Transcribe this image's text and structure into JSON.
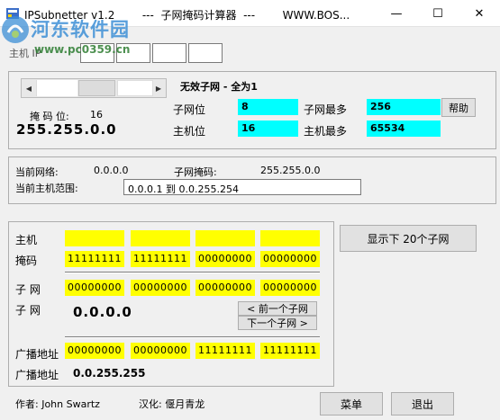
{
  "window": {
    "title": "IPSubnetter v1.2        ---  子网掩码计算器  ---        WWW.BOS...",
    "minimize": "—",
    "maximize": "☐",
    "close": "✕"
  },
  "watermark": {
    "title": "河东软件园",
    "url": "www.pc0359.cn"
  },
  "host_ip": {
    "label": "主机 IP",
    "octets": [
      "",
      "",
      "",
      "",
      ""
    ]
  },
  "mask": {
    "bits_label": "掩 码 位:",
    "bits_value": "16",
    "mask_value": "255.255.0.0",
    "subnet_status": "无效子网 - 全为1",
    "subnet_bits_label": "子网位",
    "subnet_bits_value": "8",
    "max_subnets_label": "子网最多",
    "max_subnets_value": "256",
    "host_bits_label": "主机位",
    "host_bits_value": "16",
    "max_hosts_label": "主机最多",
    "max_hosts_value": "65534",
    "help_button": "帮助",
    "scroll_level": 0.42
  },
  "network": {
    "current_network_label": "当前网络:",
    "current_network_value": "0.0.0.0",
    "subnet_mask_label": "子网掩码:",
    "subnet_mask_value": "255.255.0.0",
    "host_range_label": "当前主机范围:",
    "host_range_value": "0.0.0.1  到  0.0.255.254"
  },
  "binary": {
    "host_label": "主机",
    "host_octets": [
      "",
      "",
      "",
      ""
    ],
    "mask_label": "掩码",
    "mask_octets": [
      "11111111",
      "11111111",
      "00000000",
      "00000000"
    ],
    "subnet_label": "子 网",
    "subnet_octets": [
      "00000000",
      "00000000",
      "00000000",
      "00000000"
    ],
    "subnet2_label": "子 网",
    "subnet_value": "0.0.0.0",
    "prev_subnet": "< 前一个子网",
    "next_subnet": "下一个子网 >",
    "broadcast_label": "广播地址",
    "broadcast_octets": [
      "00000000",
      "00000000",
      "11111111",
      "11111111"
    ],
    "broadcast2_label": "广播地址",
    "broadcast_value": "0.0.255.255"
  },
  "show_subnets_button": "显示下 20个子网",
  "footer": {
    "author": "作者: John Swartz",
    "localizer": "汉化: 偃月青龙",
    "menu_button": "菜单",
    "exit_button": "退出"
  },
  "colors": {
    "cyan": "#00ffff",
    "yellow": "#ffff00"
  }
}
